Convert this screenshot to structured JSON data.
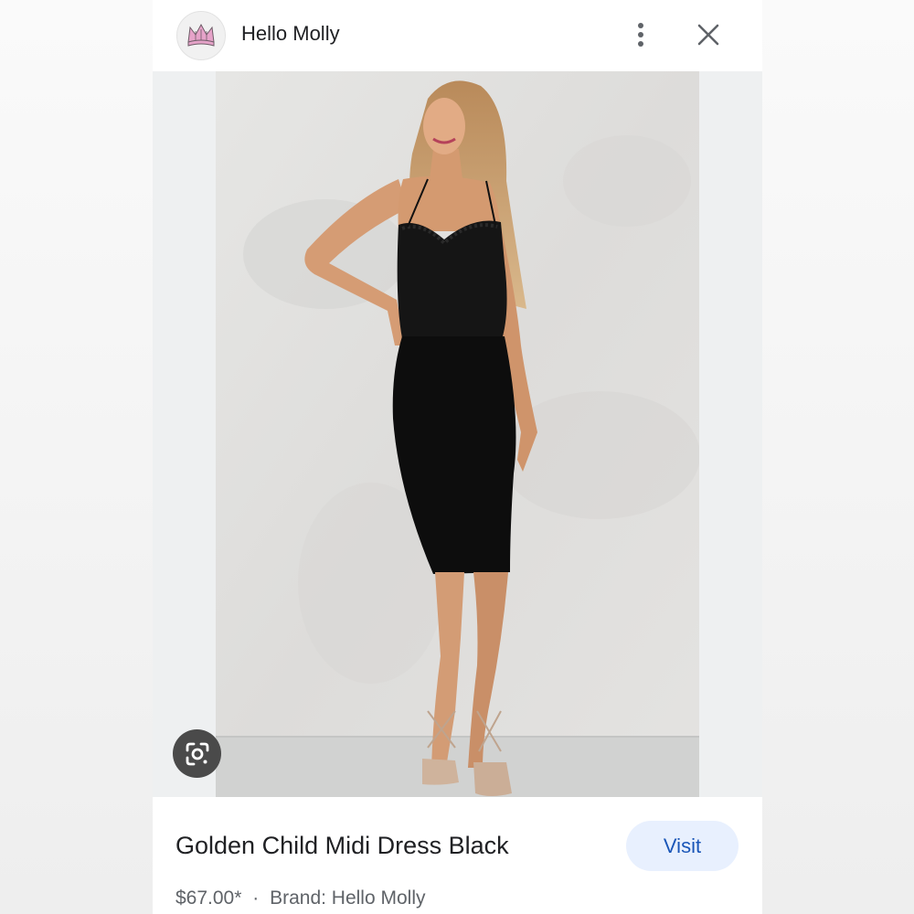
{
  "header": {
    "site_name": "Hello Molly",
    "logo_icon": "crown-icon",
    "more_icon": "more-vertical-icon",
    "close_icon": "close-icon"
  },
  "image": {
    "alt": "Woman wearing a black lace midi dress with nude strappy heels",
    "lens_icon": "google-lens-icon"
  },
  "product": {
    "title": "Golden Child Midi Dress Black",
    "price": "$67.00*",
    "separator": "·",
    "brand": "Brand: Hello Molly",
    "visit_label": "Visit"
  },
  "colors": {
    "visit_bg": "#e8f0fe",
    "visit_text": "#1a56b8",
    "logo_pink": "#e6a3c9"
  }
}
